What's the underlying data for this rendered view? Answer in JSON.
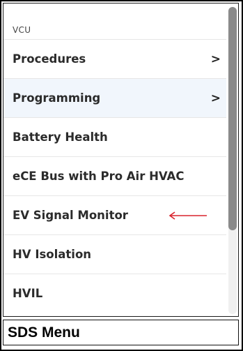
{
  "menu": {
    "section_label": "VCU",
    "items": [
      {
        "label": "Procedures",
        "chevron": ">"
      },
      {
        "label": "Programming",
        "chevron": ">"
      },
      {
        "label": "Battery Health"
      },
      {
        "label": "eCE Bus with Pro Air HVAC"
      },
      {
        "label": "EV Signal Monitor",
        "annotation": "red-arrow-icon"
      },
      {
        "label": "HV Isolation"
      },
      {
        "label": "HVIL"
      }
    ]
  },
  "footer": {
    "title": "SDS Menu"
  },
  "colors": {
    "highlight": "#f1f6fc",
    "arrow": "#d9232d",
    "scroll_thumb": "#8a8a8a"
  }
}
